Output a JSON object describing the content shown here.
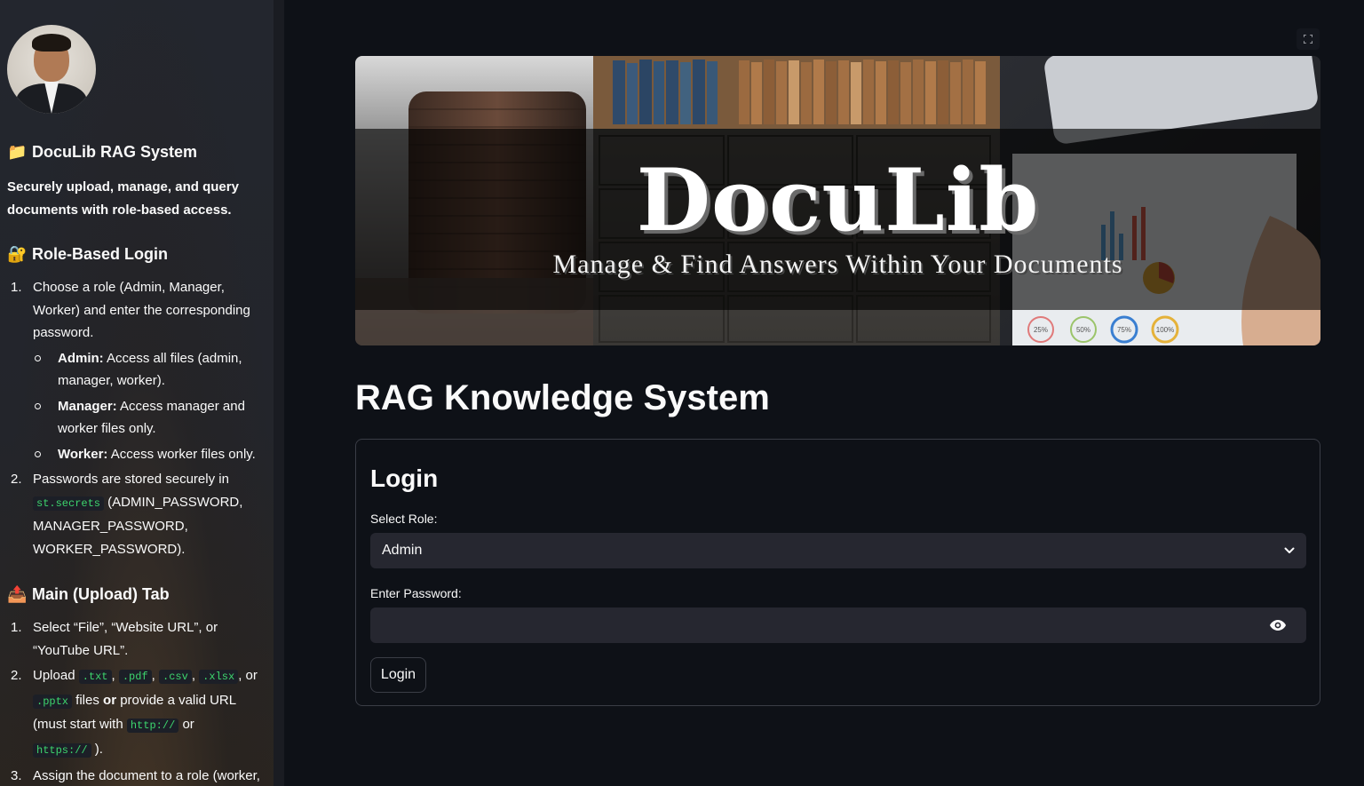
{
  "sidebar": {
    "title_emoji": "📁",
    "title": "DocuLib RAG System",
    "description": "Securely upload, manage, and query documents with role-based access.",
    "section_login": {
      "emoji": "🔐",
      "heading": "Role-Based Login",
      "item1": {
        "num": "1.",
        "text": "Choose a role (Admin, Manager, Worker) and enter the corresponding password.",
        "sub": [
          {
            "label": "Admin:",
            "text": " Access all files (admin, manager, worker)."
          },
          {
            "label": "Manager:",
            "text": " Access manager and worker files only."
          },
          {
            "label": "Worker:",
            "text": " Access worker files only."
          }
        ]
      },
      "item2": {
        "num": "2.",
        "prefix": "Passwords are stored securely in",
        "code": "st.secrets",
        "suffix": " (ADMIN_PASSWORD, MANAGER_PASSWORD, WORKER_PASSWORD)."
      }
    },
    "section_upload": {
      "emoji": "📤",
      "heading": "Main (Upload) Tab",
      "item1": {
        "num": "1.",
        "text": "Select “File”, “Website URL”, or “YouTube URL”."
      },
      "item2": {
        "num": "2.",
        "prefix": "Upload ",
        "codes": [
          ".txt",
          ".pdf",
          ".csv",
          ".xlsx",
          ".pptx"
        ],
        "sep": ", ",
        "or1": ", or ",
        "mid": " files ",
        "or2": "or",
        "after": " provide a valid URL (must start with ",
        "code_http": "http://",
        "or3": " or ",
        "code_https": "https://",
        "end": " )."
      },
      "item3": {
        "num": "3.",
        "text": "Assign the document to a role (worker,"
      }
    }
  },
  "main": {
    "banner": {
      "title": "DocuLib",
      "subtitle": "Manage & Find Answers Within Your Documents",
      "gauges": [
        "25%",
        "50%",
        "75%",
        "100%"
      ]
    },
    "page_title": "RAG Knowledge System",
    "login": {
      "heading": "Login",
      "role_label": "Select Role:",
      "role_value": "Admin",
      "password_label": "Enter Password:",
      "password_value": "",
      "button": "Login"
    }
  }
}
